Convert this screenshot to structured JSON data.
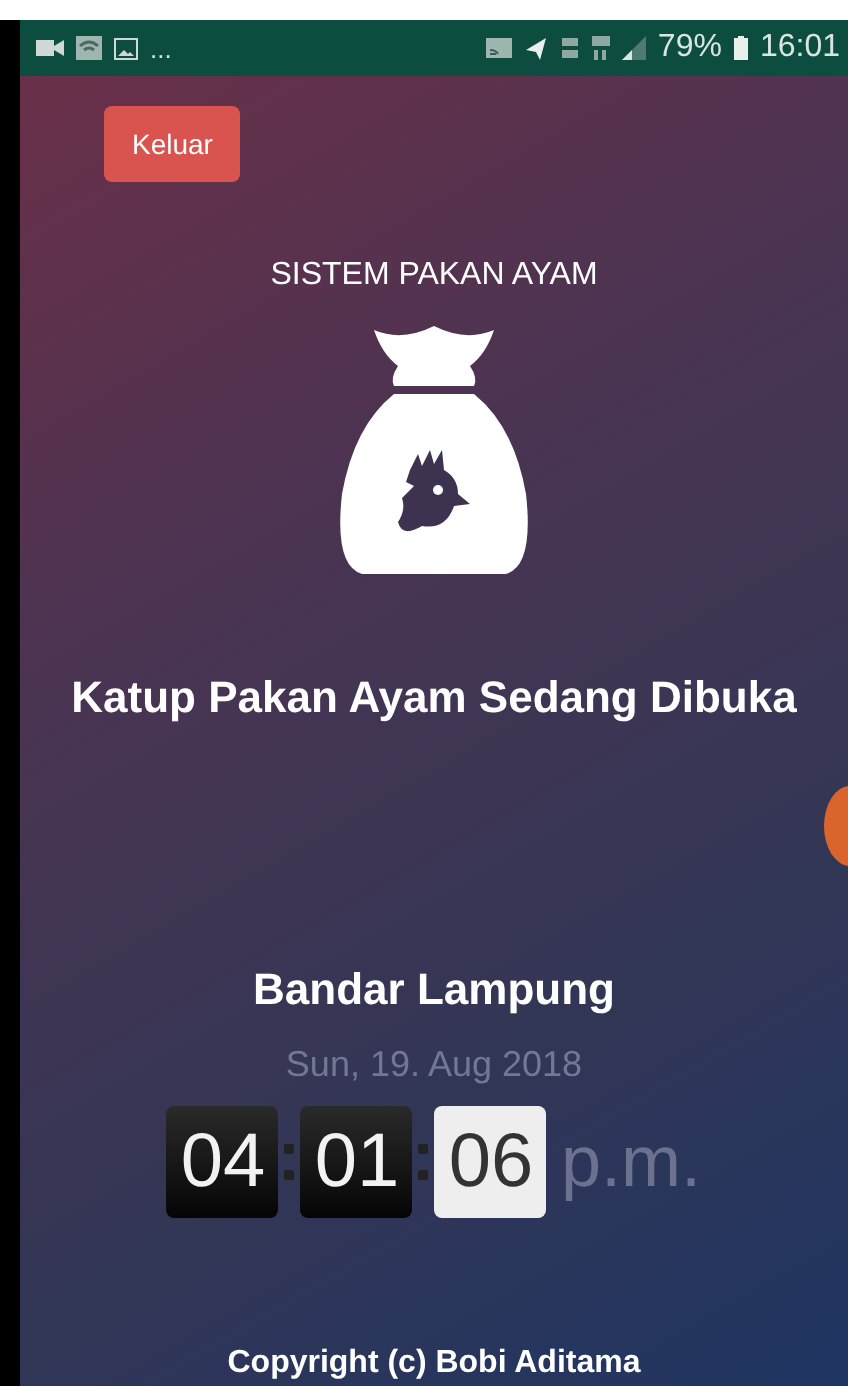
{
  "status_bar": {
    "notification_more": "...",
    "battery": "79%",
    "time": "16:01"
  },
  "logout_button": {
    "label": "Keluar"
  },
  "app_title": "SISTEM PAKAN AYAM",
  "status_message": "Katup Pakan Ayam Sedang Dibuka",
  "location": "Bandar Lampung",
  "date": "Sun, 19. Aug 2018",
  "clock": {
    "segments": [
      {
        "text": "04",
        "highlighted": false
      },
      {
        "text": "01",
        "highlighted": false
      },
      {
        "text": "06",
        "highlighted": true
      }
    ],
    "meridiem": "p.m."
  },
  "footer": "Copyright (c) Bobi Aditama"
}
